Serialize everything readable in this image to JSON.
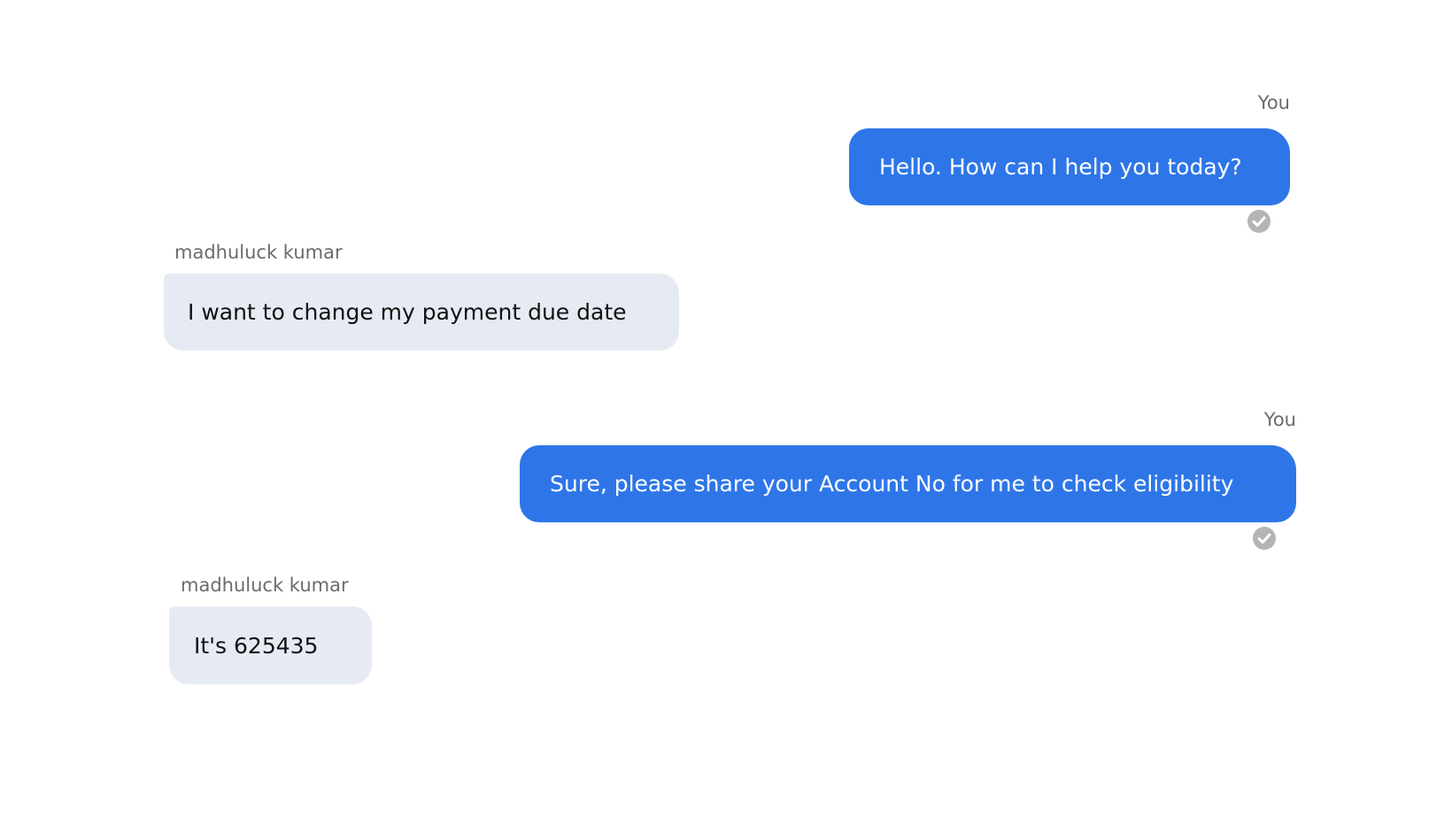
{
  "messages": [
    {
      "direction": "outgoing",
      "sender": "You",
      "text": "Hello. How can I help you today?",
      "delivered_icon": "check-circle-icon"
    },
    {
      "direction": "incoming",
      "sender": "madhuluck kumar",
      "text": "I want to change my payment due date"
    },
    {
      "direction": "outgoing",
      "sender": "You",
      "text": "Sure, please share your Account No for me to check eligibility",
      "delivered_icon": "check-circle-icon"
    },
    {
      "direction": "incoming",
      "sender": "madhuluck kumar",
      "text": "It's 625435"
    }
  ],
  "colors": {
    "outgoing_bubble": "#2e76e8",
    "incoming_bubble": "#e6ebf3",
    "sender_label": "#6b6b6b",
    "check_icon": "#b5b5b5"
  }
}
